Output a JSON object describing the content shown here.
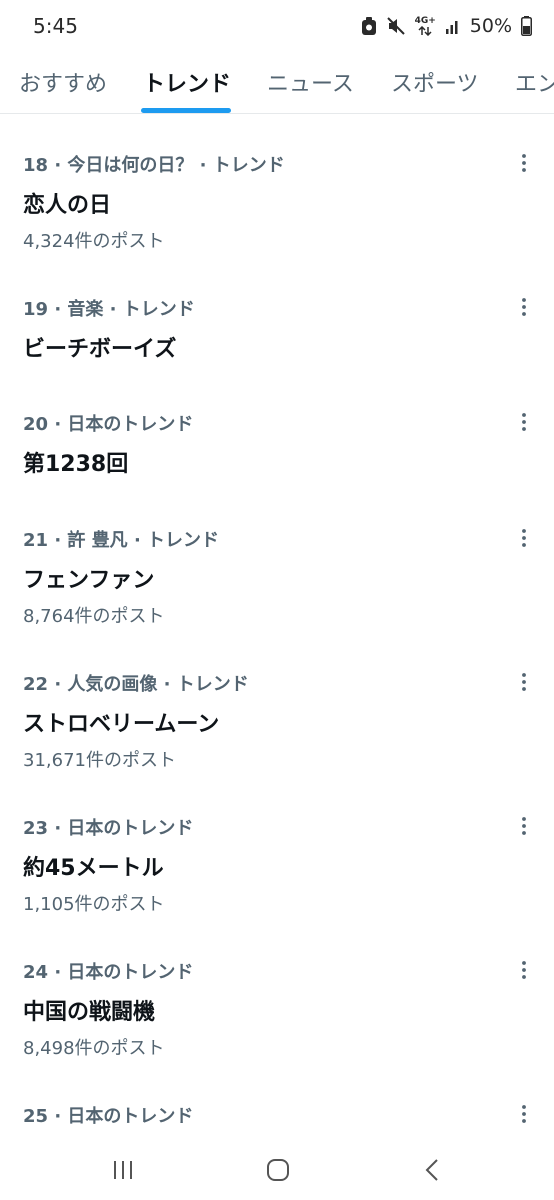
{
  "status": {
    "time": "5:45",
    "network": "4G+",
    "battery": "50%",
    "icons": [
      "screen-recorder-icon",
      "mute-icon",
      "network-icon",
      "signal-icon",
      "battery-icon"
    ]
  },
  "tabs": [
    {
      "label": "おすすめ"
    },
    {
      "label": "トレンド"
    },
    {
      "label": "ニュース"
    },
    {
      "label": "スポーツ"
    },
    {
      "label": "エン"
    }
  ],
  "active_tab": "トレンド",
  "accent_color": "#1d9bf0",
  "trends": [
    {
      "meta": "18 · 今日は何の日？ · トレンド",
      "title": "恋人の日",
      "count": "4,324件のポスト"
    },
    {
      "meta": "19 · 音楽 · トレンド",
      "title": "ビーチボーイズ",
      "count": ""
    },
    {
      "meta": "20 · 日本のトレンド",
      "title": "第1238回",
      "count": ""
    },
    {
      "meta": "21 · 許 豊凡 · トレンド",
      "title": "フェンファン",
      "count": "8,764件のポスト"
    },
    {
      "meta": "22 · 人気の画像 · トレンド",
      "title": "ストロベリームーン",
      "count": "31,671件のポスト"
    },
    {
      "meta": "23 · 日本のトレンド",
      "title": "約45メートル",
      "count": "1,105件のポスト"
    },
    {
      "meta": "24 · 日本のトレンド",
      "title": "中国の戦闘機",
      "count": "8,498件のポスト"
    },
    {
      "meta": "25 · 日本のトレンド",
      "title": "",
      "count": ""
    }
  ],
  "nav": {
    "icons": [
      "recent-apps-icon",
      "home-icon",
      "back-icon"
    ]
  }
}
